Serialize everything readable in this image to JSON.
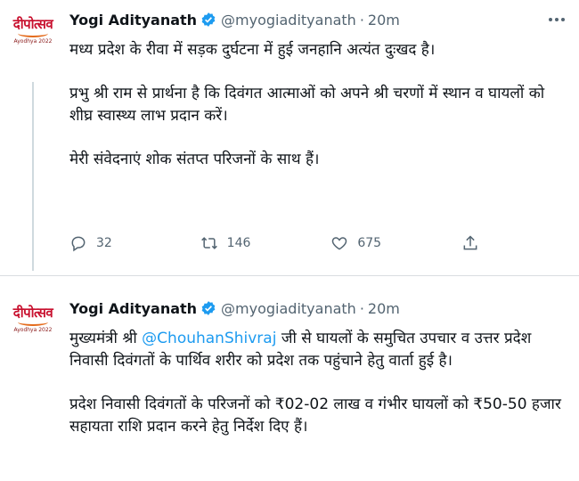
{
  "tweets": [
    {
      "author": {
        "name": "Yogi Adityanath",
        "handle": "@myogiadityanath",
        "time": "20m",
        "avatar_text": "दीपोत्सव",
        "avatar_subtext": "Ayodhya 2022"
      },
      "paragraphs": [
        "मध्य प्रदेश के रीवा में सड़क दुर्घटना में हुई जनहानि अत्यंत दुःखद है।",
        "प्रभु श्री राम से प्रार्थना है कि दिवंगत आत्माओं को अपने श्री चरणों में स्थान व घायलों को शीघ्र स्वास्थ्य लाभ प्रदान करें।",
        "मेरी संवेदनाएं शोक संतप्त परिजनों के साथ हैं।"
      ],
      "actions": {
        "replies": "32",
        "retweets": "146",
        "likes": "675"
      }
    },
    {
      "author": {
        "name": "Yogi Adityanath",
        "handle": "@myogiadityanath",
        "time": "20m",
        "avatar_text": "दीपोत्सव",
        "avatar_subtext": "Ayodhya 2022"
      },
      "p1_before": "मुख्यमंत्री श्री ",
      "p1_mention": "@ChouhanShivraj",
      "p1_after": " जी से घायलों के समुचित उपचार व उत्तर प्रदेश निवासी दिवंगतों के पार्थिव शरीर को प्रदेश तक पहुंचाने हेतु वार्ता हुई है।",
      "p2": "प्रदेश निवासी दिवंगतों के परिजनों को ₹02-02 लाख व गंभीर घायलों को ₹50-50 हजार सहायता राशि प्रदान करने हेतु निर्देश दिए हैं।"
    }
  ],
  "colors": {
    "accent": "#1d9bf0",
    "muted": "#536471",
    "text": "#0f1419"
  },
  "icons": [
    "verified-badge-icon",
    "more-icon",
    "reply-icon",
    "retweet-icon",
    "like-icon",
    "share-icon"
  ]
}
